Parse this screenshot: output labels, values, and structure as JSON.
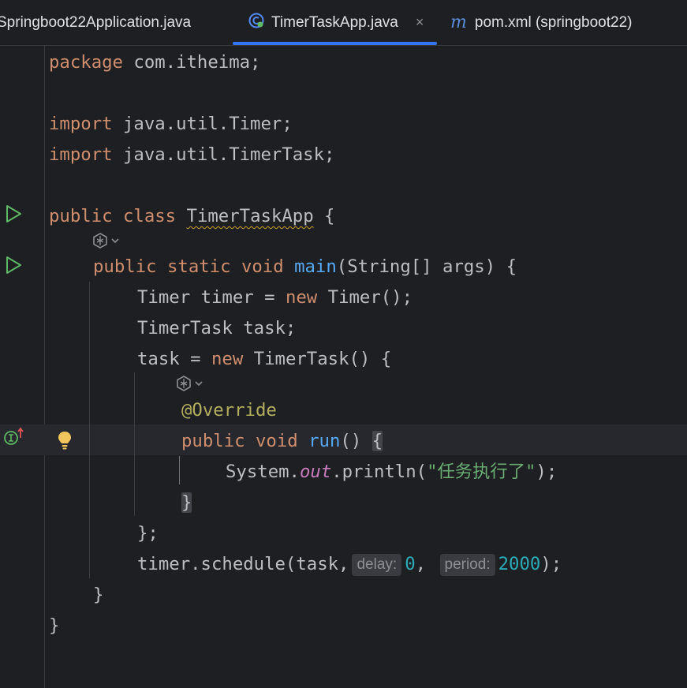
{
  "tabs": [
    {
      "label": "Springboot22Application.java",
      "active": false
    },
    {
      "label": "TimerTaskApp.java",
      "active": true,
      "close": "×"
    },
    {
      "label": "pom.xml (springboot22)",
      "active": false,
      "icon_text": "m"
    }
  ],
  "code": {
    "l1_kw": "package",
    "l1_rest": " com.itheima;",
    "l3_kw": "import",
    "l3_rest": " java.util.Timer;",
    "l4_kw": "import",
    "l4_rest": " java.util.TimerTask;",
    "l6_kw1": "public",
    "l6_kw2": " class",
    "l6_sp": " ",
    "l6_name": "TimerTaskApp",
    "l6_brace": " {",
    "l7_kw1": "public",
    "l7_kw2": " static",
    "l7_kw3": " void",
    "l7_sp": " ",
    "l7_fn": "main",
    "l7_rest": "(String[] args) {",
    "l8_a": "Timer timer = ",
    "l8_kw": "new",
    "l8_b": " Timer();",
    "l9": "TimerTask task;",
    "l10_a": "task = ",
    "l10_kw": "new",
    "l10_b": " TimerTask() {",
    "l11_ann": "@Override",
    "l12_kw1": "public",
    "l12_kw2": " void",
    "l12_sp": " ",
    "l12_fn": "run",
    "l12_paren": "() ",
    "l12_brace": "{",
    "l13_a": "System.",
    "l13_field": "out",
    "l13_b": ".println(",
    "l13_str": "\"任务执行了\"",
    "l13_c": ");",
    "l14_brace": "}",
    "l15": "};",
    "l16_a": "timer.schedule(task,",
    "l16_hint1": "delay:",
    "l16_num1": "0",
    "l16_comma": ",",
    "l16_hint2": "period:",
    "l16_num2": "2000",
    "l16_end": ");",
    "l17": "}",
    "l18": "}"
  },
  "colors": {
    "keyword": "#cf8e6d",
    "function": "#56a8f5",
    "string": "#6aab73",
    "number": "#2aacb8",
    "annotation": "#b3ae60",
    "accent": "#3574f0"
  },
  "icons": [
    "run-icon",
    "run-icon",
    "ai-assistant-icon",
    "ai-assistant-icon",
    "implements-method-icon",
    "lightbulb-icon",
    "java-class-icon",
    "maven-icon",
    "close-icon"
  ]
}
